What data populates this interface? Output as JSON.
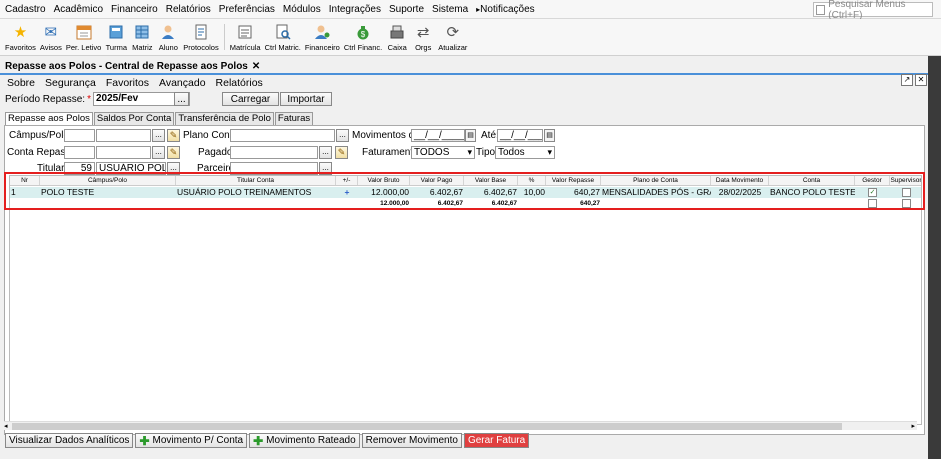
{
  "menubar": {
    "items": [
      "Cadastro",
      "Acadêmico",
      "Financeiro",
      "Relatórios",
      "Preferências",
      "Módulos",
      "Integrações",
      "Suporte",
      "Sistema",
      "Notificações"
    ],
    "search_placeholder": "Pesquisar Menus (Ctrl+F)"
  },
  "toolbar": {
    "items": [
      {
        "label": "Favoritos",
        "icon": "star-icon"
      },
      {
        "label": "Avisos",
        "icon": "mail-icon"
      },
      {
        "label": "Per. Letivo",
        "icon": "calendar-icon"
      },
      {
        "label": "Turma",
        "icon": "class-icon"
      },
      {
        "label": "Matriz",
        "icon": "grid-icon"
      },
      {
        "label": "Aluno",
        "icon": "student-icon"
      },
      {
        "label": "Protocolos",
        "icon": "protocol-icon"
      },
      {
        "label": "Matrícula",
        "icon": "enrollment-icon"
      },
      {
        "label": "Ctrl Matric.",
        "icon": "search-document-icon"
      },
      {
        "label": "Financeiro",
        "icon": "finance-user-icon"
      },
      {
        "label": "Ctrl Financ.",
        "icon": "money-bag-icon"
      },
      {
        "label": "Caixa",
        "icon": "cash-register-icon"
      },
      {
        "label": "Orgs",
        "icon": "swap-icon"
      },
      {
        "label": "Atualizar",
        "icon": "refresh-icon"
      }
    ]
  },
  "doc_tab": {
    "title": "Repasse aos Polos - Central de Repasse aos Polos",
    "close": "✕"
  },
  "submenu": {
    "items": [
      "Sobre",
      "Segurança",
      "Favoritos",
      "Avançado",
      "Relatórios"
    ]
  },
  "periodo": {
    "label": "Período Repasse:",
    "required_mark": "*",
    "value": "2025/Fev",
    "dots": "...",
    "carregar": "Carregar",
    "importar": "Importar"
  },
  "tabs": [
    "Repasse aos Polos",
    "Saldos Por Conta",
    "Transferência de Polo",
    "Faturas"
  ],
  "filters": {
    "campus_label": "Câmpus/Polo:",
    "plano_label": "Plano Conta:",
    "movimentos_label": "Movimentos de:",
    "movimentos_value": "__/__/____",
    "ate_label": "Até:",
    "ate_value": "__/__/____",
    "conta_label": "Conta Repasse:",
    "pagador_label": "Pagador:",
    "faturamento_label": "Faturamento:",
    "faturamento_value": "TODOS",
    "tipo_label": "Tipo:",
    "tipo_value": "Todos",
    "titular_label": "Titular:",
    "titular_code": "59",
    "titular_name": "USUÁRIO POLO TR",
    "parceiro_label": "Parceiro:",
    "dots": "..."
  },
  "grid": {
    "headers": [
      "Nr",
      "Câmpus/Polo",
      "Titular Conta",
      "+/-",
      "Valor Bruto",
      "Valor Pago",
      "Valor Base",
      "%",
      "Valor Repasse",
      "Plano de Conta",
      "Data Movimento",
      "Conta",
      "Gestor",
      "Supervisor"
    ],
    "rows": [
      {
        "nr": "1",
        "campus": "POLO TESTE",
        "titular": "USUÁRIO POLO TREINAMENTOS",
        "plusminus": "+",
        "valor_bruto": "12.000,00",
        "valor_pago": "6.402,67",
        "valor_base": "6.402,67",
        "pct": "10,00",
        "valor_repasse": "640,27",
        "plano": "MENSALIDADES PÓS - GRA...",
        "data": "28/02/2025",
        "conta": "BANCO POLO TESTE",
        "gestor_checked": true,
        "supervisor_checked": false
      }
    ],
    "totals": {
      "valor_bruto": "12.000,00",
      "valor_pago": "6.402,67",
      "valor_base": "6.402,67",
      "valor_repasse": "640,27"
    }
  },
  "bottom_buttons": {
    "analiticos": "Visualizar Dados Analíticos",
    "mov_conta": "Movimento P/ Conta",
    "mov_rateado": "Movimento Rateado",
    "remover": "Remover Movimento",
    "gerar": "Gerar Fatura"
  },
  "colors": {
    "highlight": "#e41e1e",
    "selected_row": "#d9efef",
    "gerar_fatura": "#e04040"
  }
}
